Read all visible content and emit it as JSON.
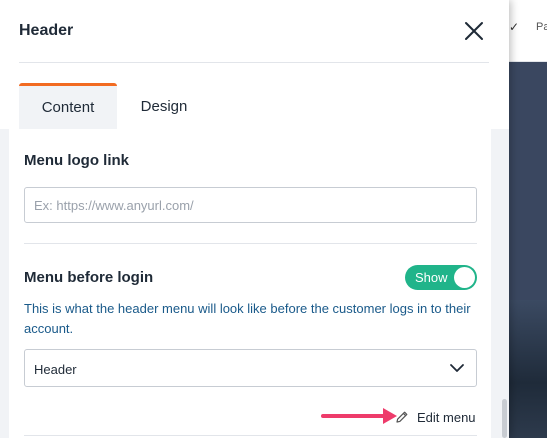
{
  "background": {
    "check_glyph": "✓",
    "partial_text": "Pa"
  },
  "panel": {
    "title": "Header",
    "close_icon": "close-icon"
  },
  "tabs": [
    {
      "label": "Content",
      "active": true
    },
    {
      "label": "Design",
      "active": false
    }
  ],
  "menu_logo_link": {
    "title": "Menu logo link",
    "placeholder": "Ex: https://www.anyurl.com/",
    "value": ""
  },
  "menu_before_login": {
    "title": "Menu before login",
    "toggle_label": "Show",
    "toggle_on": true,
    "help_text": "This is what the header menu will look like before the customer logs in to their account.",
    "selected": "Header",
    "edit_label": "Edit menu"
  },
  "colors": {
    "accent_tab": "#f26b21",
    "toggle_on": "#20b48a",
    "help_text": "#1a5a8a",
    "arrow": "#ee3b6b"
  }
}
